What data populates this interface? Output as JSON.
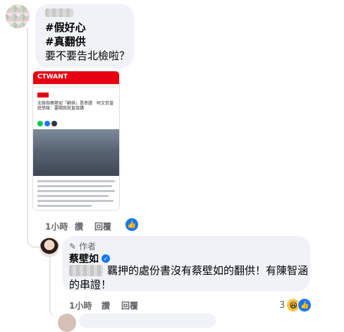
{
  "comment1": {
    "avatar_icon": "pixelated-avatar-icon",
    "lines": [
      "#假好心",
      "#真翻供",
      "要不要告北檢啦？"
    ],
    "article": {
      "logo": "CTWANT",
      "tag": "",
      "title": "北檢指蔡壁如「翻供」是串證　柯文哲當庭怒嗆：要關我就直接講"
    },
    "actions": {
      "time": "1小時",
      "like": "讚",
      "reply": "回覆"
    },
    "reaction_icon": "like-icon"
  },
  "comment2": {
    "author_badge": "作者",
    "name": "蔡壁如",
    "line1": "羈押的處份書沒有蔡壁如的翻供！有陳智涵",
    "line2": "的串證！",
    "actions": {
      "time": "1小時",
      "like": "讚",
      "reply": "回覆"
    },
    "reaction_count": "3",
    "reaction_icons": [
      "haha-icon",
      "like-icon"
    ]
  },
  "colors": {
    "bubble": "#f0f2f5",
    "accent": "#1877f2",
    "muted": "#65676b"
  }
}
